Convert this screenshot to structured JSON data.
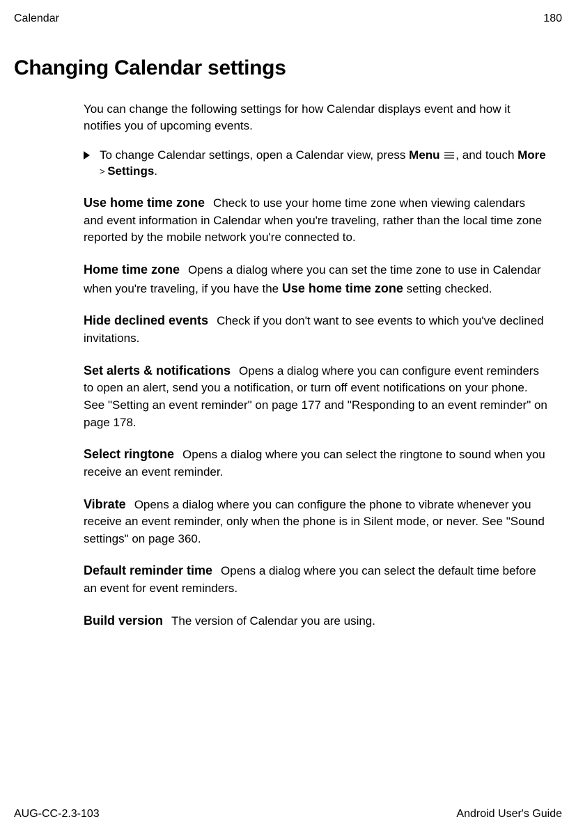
{
  "header": {
    "section": "Calendar",
    "page_number": "180"
  },
  "title": "Changing Calendar settings",
  "intro": "You can change the following settings for how Calendar displays event and how it notifies you of upcoming events.",
  "instruction": {
    "pre": "To change Calendar settings, open a Calendar view, press ",
    "menu": "Menu",
    "mid": ", and touch ",
    "more": "More",
    "sep": " > ",
    "settings": "Settings",
    "end": "."
  },
  "settings": {
    "use_home_tz": {
      "name": "Use home time zone",
      "desc": "Check to use your home time zone when viewing calendars and event information in Calendar when you're traveling, rather than the local time zone reported by the mobile network you're connected to."
    },
    "home_tz": {
      "name": "Home time zone",
      "desc_pre": "Opens a dialog where you can set the time zone to use in Calendar when you're traveling, if you have the ",
      "bold": "Use home time zone",
      "desc_post": " setting checked."
    },
    "hide_declined": {
      "name": "Hide declined events",
      "desc": "Check if you don't want to see events to which you've declined invitations."
    },
    "alerts": {
      "name": "Set alerts & notifications",
      "desc": "Opens a dialog where you can configure event reminders to open an alert, send you a notification, or turn off event notifications on your phone. See \"Setting an event reminder\" on page 177 and \"Responding to an event reminder\" on page 178."
    },
    "ringtone": {
      "name": "Select ringtone",
      "desc": "Opens a dialog where you can select the ringtone to sound when you receive an event reminder."
    },
    "vibrate": {
      "name": "Vibrate",
      "desc": "Opens a dialog where you can configure the phone to vibrate whenever you receive an event reminder, only when the phone is in Silent mode, or never. See \"Sound settings\" on page 360."
    },
    "default_reminder": {
      "name": "Default reminder time",
      "desc": "Opens a dialog where you can select the default time before an event for event reminders."
    },
    "build": {
      "name": "Build version",
      "desc": "The version of Calendar you are using."
    }
  },
  "footer": {
    "left": "AUG-CC-2.3-103",
    "right": "Android User's Guide"
  }
}
